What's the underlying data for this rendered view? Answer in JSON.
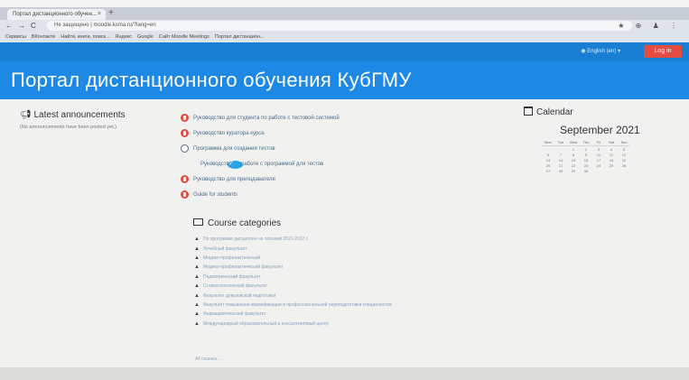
{
  "browser": {
    "tab_title": "Портал дистанционного обучен...",
    "tab_close": "×",
    "new_tab": "+",
    "url": "Не защищено | moodle.ksma.ru/?lang=en",
    "bookmarks": [
      "Сервисы",
      "ВКонтакте",
      "Найти, книги, поиск...",
      "Яндекс",
      "Google",
      "Сайт Moodle Meetings",
      "Портал дистанцион..."
    ],
    "controls_right": "★ ⊕ ♟ ⋮"
  },
  "header": {
    "language": "English (en)",
    "login_label": "Log in",
    "site_title": "Портал дистанционного обучения КубГМУ"
  },
  "announcements": {
    "title": "Latest announcements",
    "empty_text": "(No announcements have been posted yet.)"
  },
  "documents": [
    {
      "type": "pdf",
      "label": "Руководство для студента по работе с тестовой системой"
    },
    {
      "type": "pdf",
      "label": "Руководство куратора курса"
    },
    {
      "type": "quiz",
      "label": "Программа для создания тестов"
    },
    {
      "type": "url",
      "label": "Руководство по работе с программой для тестов"
    },
    {
      "type": "pdf",
      "label": "Руководство для преподавателя"
    },
    {
      "type": "pdf",
      "label": "Guide for students"
    }
  ],
  "calendar": {
    "title": "Calendar",
    "month": "September 2021",
    "weekdays": [
      "Mon",
      "Tue",
      "Wed",
      "Thu",
      "Fri",
      "Sat",
      "Sun"
    ],
    "weeks": [
      [
        "",
        "",
        "1",
        "2",
        "3",
        "4",
        "5"
      ],
      [
        "6",
        "7",
        "8",
        "9",
        "10",
        "11",
        "12"
      ],
      [
        "13",
        "14",
        "15",
        "16",
        "17",
        "18",
        "19"
      ],
      [
        "20",
        "21",
        "22",
        "23",
        "24",
        "25",
        "26"
      ],
      [
        "27",
        "28",
        "29",
        "30",
        "",
        "",
        ""
      ]
    ]
  },
  "categories": {
    "title": "Course categories",
    "items": [
      "По программе дисциплин на осенний 2021-2022 г.",
      "Лечебный факультет",
      "Медико-профилактический",
      "Медико-профилактический факультет",
      "Педиатрический факультет",
      "Стоматологический факультет",
      "Факультет довузовской подготовки",
      "Факультет повышения квалификации и профессиональной переподготовки специалистов",
      "Фармацевтический факультет",
      "Международный образовательный и консалтинговый центр"
    ],
    "all_courses": "All courses ..."
  },
  "colors": {
    "nav_bar": "#1a7fd4",
    "banner": "#1e88e5",
    "login_button": "#e24c43",
    "page_bg": "#f1f2f0"
  }
}
